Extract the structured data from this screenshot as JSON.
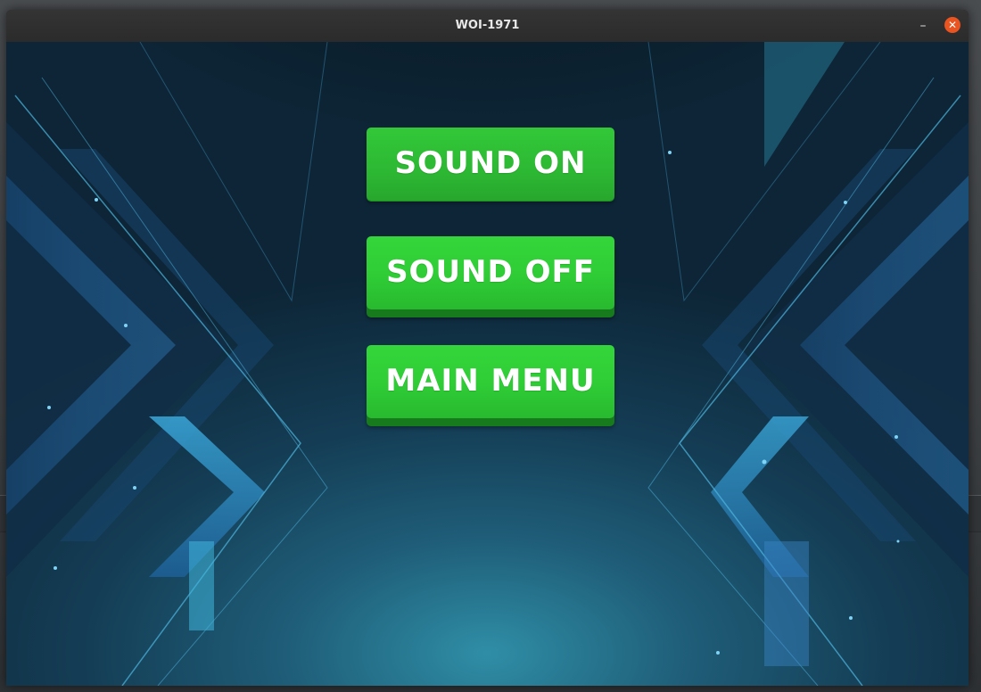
{
  "window": {
    "title": "WOI-1971",
    "minimize_glyph": "–",
    "close_glyph": "✕"
  },
  "menu": {
    "sound_on_label": "SOUND ON",
    "sound_off_label": "SOUND OFF",
    "main_menu_label": "MAIN MENU"
  },
  "colors": {
    "button_green": "#2fcc36",
    "button_shadow": "#177a1c",
    "close_orange": "#e95420",
    "background_teal": "#1f5d78"
  }
}
